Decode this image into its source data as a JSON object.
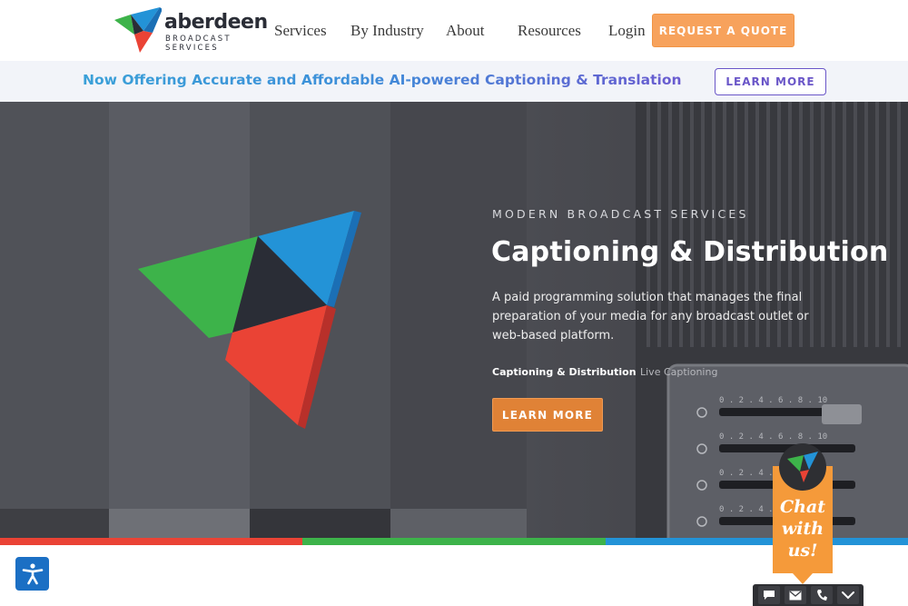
{
  "brand": {
    "name": "aberdeen",
    "tagline_line1": "BROADCAST",
    "tagline_line2": "SERVICES",
    "colors": {
      "green": "#3db34a",
      "blue": "#2393d7",
      "red": "#ea4335",
      "dark": "#2a2d36"
    }
  },
  "nav": {
    "items": [
      {
        "label": "Services"
      },
      {
        "label": "By Industry"
      },
      {
        "label": "About"
      },
      {
        "label": "Resources"
      },
      {
        "label": "Login"
      }
    ],
    "cta_label": "REQUEST A QUOTE"
  },
  "banner": {
    "text": "Now Offering Accurate and Affordable AI-powered Captioning & Translation",
    "button_label": "LEARN MORE"
  },
  "hero": {
    "eyebrow": "MODERN BROADCAST SERVICES",
    "title": "Captioning & Distribution",
    "description": "A paid programming solution that manages the final preparation of your media for any broadcast outlet or web-based platform.",
    "tabs": [
      {
        "label": "Captioning & Distribution",
        "active": true
      },
      {
        "label": "Live Captioning",
        "active": false
      }
    ],
    "button_label": "LEARN MORE",
    "dial_scale": "0 . 2 . 4 . 6 . 8 . 10"
  },
  "colorbar": [
    "#ea4335",
    "#3db34a",
    "#2393d7"
  ],
  "chat": {
    "line1": "Chat",
    "line2": "with",
    "line3": "us!",
    "accent": "#f59a3a",
    "toolbar_icons": [
      "message-icon",
      "mail-icon",
      "phone-icon",
      "chevron-down-icon"
    ]
  },
  "accessibility": {
    "icon": "accessibility-icon",
    "color": "#1b6fc4"
  }
}
